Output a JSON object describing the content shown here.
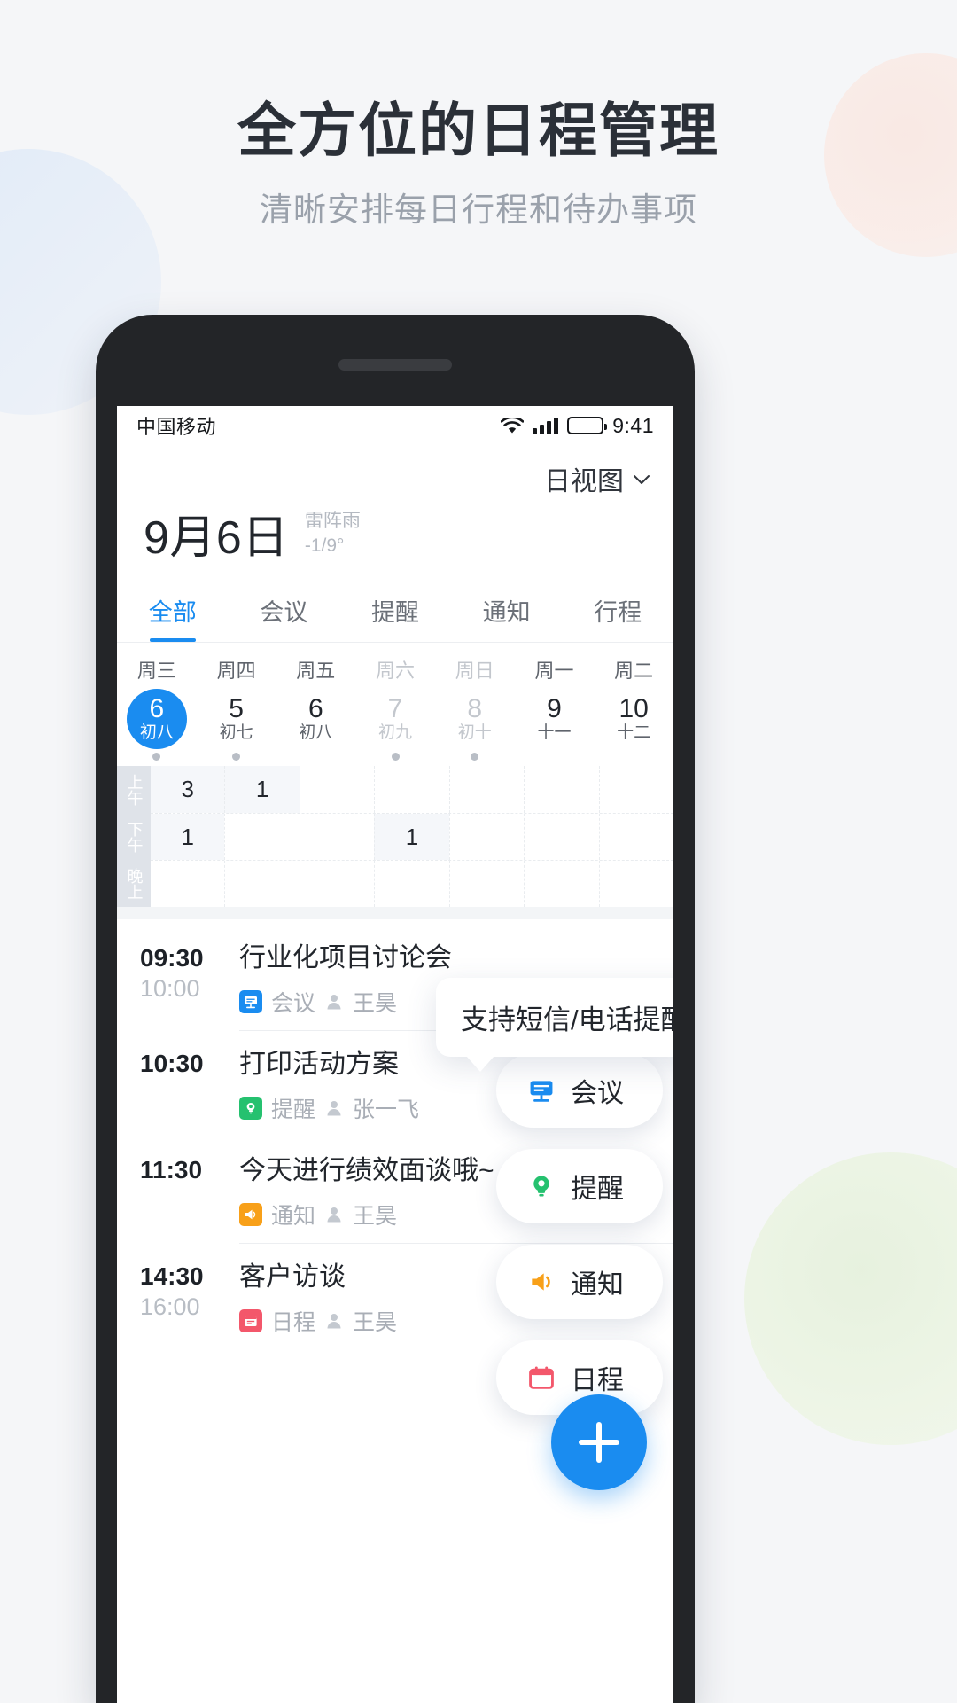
{
  "page": {
    "headline": "全方位的日程管理",
    "subheadline": "清晰安排每日行程和待办事项",
    "accent_color": "#1a8cf0",
    "background_color": "#f5f6f8"
  },
  "statusbar": {
    "carrier": "中国移动",
    "time": "9:41",
    "wifi_icon": "wifi-icon",
    "signal_icon": "cellular-signal-icon",
    "battery_icon": "battery-icon"
  },
  "viewswitch": {
    "label": "日视图",
    "chevron_icon": "chevron-down-icon"
  },
  "dateheader": {
    "date": "9月6日",
    "weather": "雷阵雨",
    "temperature": "-1/9°"
  },
  "tabs": [
    {
      "label": "全部",
      "active": true
    },
    {
      "label": "会议",
      "active": false
    },
    {
      "label": "提醒",
      "active": false
    },
    {
      "label": "通知",
      "active": false
    },
    {
      "label": "行程",
      "active": false
    }
  ],
  "week": [
    {
      "weekday": "周三",
      "day": "6",
      "lunar": "初八",
      "selected": true,
      "dim": false,
      "dot": true
    },
    {
      "weekday": "周四",
      "day": "5",
      "lunar": "初七",
      "selected": false,
      "dim": false,
      "dot": true
    },
    {
      "weekday": "周五",
      "day": "6",
      "lunar": "初八",
      "selected": false,
      "dim": false,
      "dot": false
    },
    {
      "weekday": "周六",
      "day": "7",
      "lunar": "初九",
      "selected": false,
      "dim": true,
      "dot": true
    },
    {
      "weekday": "周日",
      "day": "8",
      "lunar": "初十",
      "selected": false,
      "dim": true,
      "dot": true
    },
    {
      "weekday": "周一",
      "day": "9",
      "lunar": "十一",
      "selected": false,
      "dim": false,
      "dot": false
    },
    {
      "weekday": "周二",
      "day": "10",
      "lunar": "十二",
      "selected": false,
      "dim": false,
      "dot": false
    }
  ],
  "minigrid": {
    "row_labels": [
      "上午",
      "下午",
      "晚上"
    ],
    "rows": [
      [
        "3",
        "1",
        "",
        "",
        "",
        "",
        ""
      ],
      [
        "1",
        "",
        "",
        "1",
        "",
        "",
        ""
      ],
      [
        "",
        "",
        "",
        "",
        "",
        "",
        ""
      ]
    ]
  },
  "events": [
    {
      "start": "09:30",
      "end": "10:00",
      "title": "行业化项目讨论会",
      "type": "会议",
      "type_icon": "meeting-icon",
      "type_color": "#1a8cf0",
      "person": "王昊"
    },
    {
      "start": "10:30",
      "end": "",
      "title": "打印活动方案",
      "type": "提醒",
      "type_icon": "reminder-bulb-icon",
      "type_color": "#25c16f",
      "person": "张一飞"
    },
    {
      "start": "11:30",
      "end": "",
      "title": "今天进行绩效面谈哦~",
      "type": "通知",
      "type_icon": "notification-horn-icon",
      "type_color": "#f8a019",
      "person": "王昊"
    },
    {
      "start": "14:30",
      "end": "16:00",
      "title": "客户访谈",
      "type": "日程",
      "type_icon": "schedule-calendar-icon",
      "type_color": "#f3576b",
      "person": "王昊"
    }
  ],
  "tooltip": {
    "text": "支持短信/电话提醒"
  },
  "pills": [
    {
      "label": "会议",
      "icon": "meeting-icon",
      "color": "#1a8cf0"
    },
    {
      "label": "提醒",
      "icon": "reminder-bulb-icon",
      "color": "#25c16f"
    },
    {
      "label": "通知",
      "icon": "notification-horn-icon",
      "color": "#f8a019"
    },
    {
      "label": "日程",
      "icon": "schedule-calendar-icon",
      "color": "#f3576b"
    }
  ],
  "fab": {
    "icon": "plus-icon",
    "color": "#1a8cf0"
  }
}
